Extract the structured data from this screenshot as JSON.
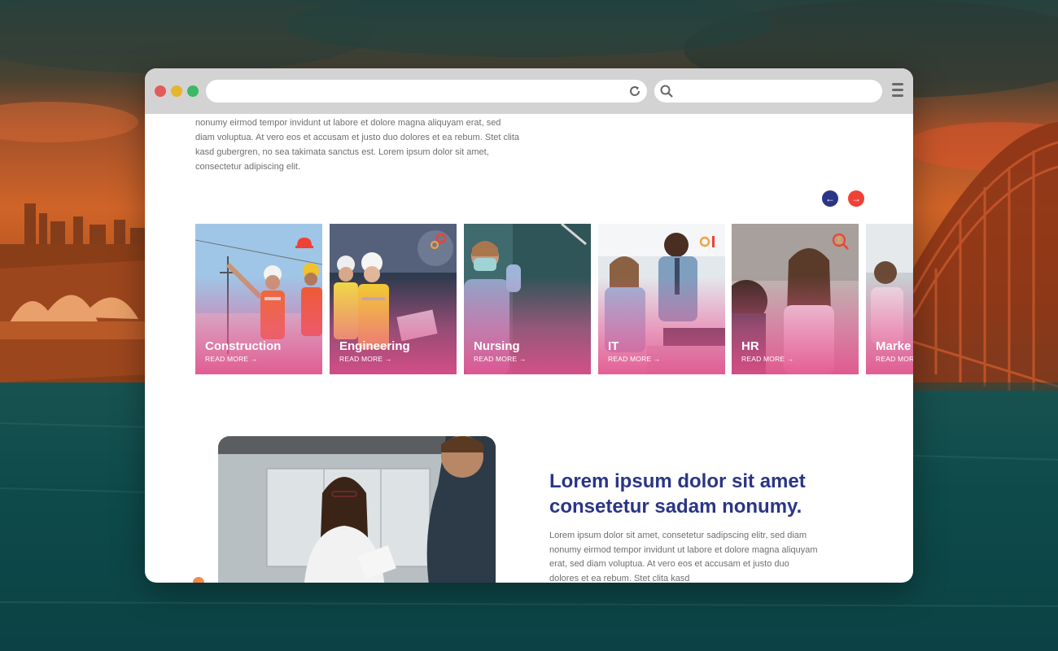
{
  "intro_text": "nonumy eirmod tempor invidunt ut labore et dolore magna aliquyam erat, sed diam voluptua. At vero eos et accusam et justo duo dolores et ea rebum. Stet clita kasd gubergren, no sea takimata sanctus est. Lorem ipsum dolor sit amet, consectetur adipiscing elit.",
  "carousel": {
    "prev_glyph": "←",
    "next_glyph": "→",
    "cards": [
      {
        "title": "Construction",
        "more": "READ MORE →",
        "icon": "hard-hat-icon"
      },
      {
        "title": "Engineering",
        "more": "READ MORE →",
        "icon": "gears-icon"
      },
      {
        "title": "Nursing",
        "more": "READ MORE →",
        "icon": "none"
      },
      {
        "title": "IT",
        "more": "READ MORE →",
        "icon": "tech-gear-icon"
      },
      {
        "title": "HR",
        "more": "READ MORE →",
        "icon": "person-search-icon"
      },
      {
        "title": "Marke",
        "more": "READ MOR",
        "icon": "none"
      }
    ]
  },
  "feature": {
    "headline": "Lorem ipsum dolor sit amet consetetur sadam nonumy.",
    "body": "Lorem ipsum dolor sit amet, consetetur sadipscing elitr, sed diam nonumy eirmod tempor invidunt ut labore et dolore magna aliquyam erat, sed diam voluptua. At vero eos et accusam et justo duo dolores et ea rebum. Stet clita kasd"
  },
  "colors": {
    "primary": "#2b3586",
    "accent": "#ef4136",
    "card_gradient": "#e4508c",
    "text_muted": "#6f6f6f"
  }
}
